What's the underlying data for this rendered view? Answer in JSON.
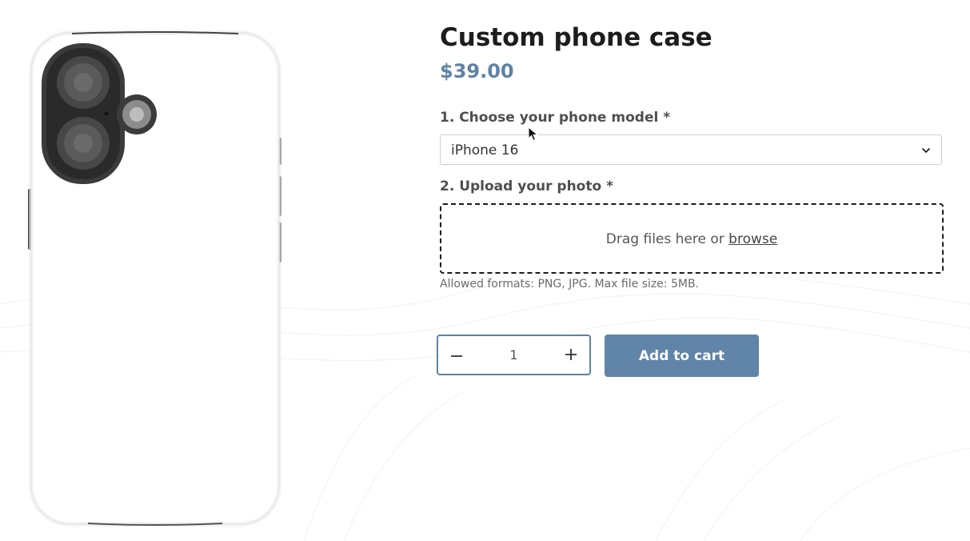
{
  "product": {
    "title": "Custom phone case",
    "price": "$39.00"
  },
  "options": {
    "model_label": "1. Choose your phone model *",
    "model_selected": "iPhone 16",
    "photo_label": "2. Upload your photo *"
  },
  "upload": {
    "drop_text": "Drag files here or ",
    "browse_label": "browse",
    "hint": "Allowed formats: PNG, JPG. Max file size: 5MB."
  },
  "quantity": {
    "value": "1",
    "minus_icon": "minus-icon",
    "plus_icon": "plus-icon"
  },
  "cart": {
    "add_label": "Add to cart"
  },
  "colors": {
    "accent": "#6085a8",
    "price": "#5f82a5"
  }
}
